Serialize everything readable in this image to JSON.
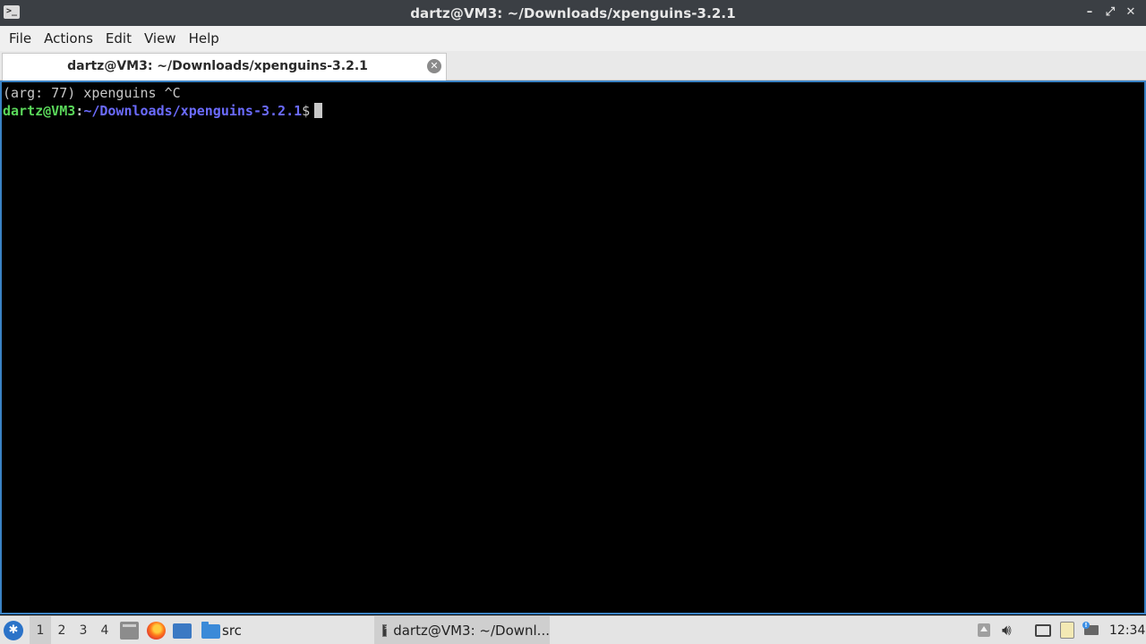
{
  "window": {
    "title": "dartz@VM3: ~/Downloads/xpenguins-3.2.1",
    "minimize_glyph": "–",
    "maximize_glyph": "⤢",
    "close_glyph": "✕"
  },
  "menubar": {
    "items": [
      "File",
      "Actions",
      "Edit",
      "View",
      "Help"
    ]
  },
  "tabs": [
    {
      "label": "dartz@VM3: ~/Downloads/xpenguins-3.2.1",
      "close_glyph": "✕"
    }
  ],
  "terminal": {
    "lines": [
      "(arg: 77) xpenguins ^C"
    ],
    "prompt": {
      "user_host": "dartz@VM3",
      "separator": ":",
      "path": "~/Downloads/xpenguins-3.2.1",
      "symbol": "$"
    },
    "colors": {
      "background": "#000000",
      "text": "#c8c8c8",
      "user_host": "#5ad75a",
      "path": "#6b6bff",
      "border": "#3a82c4"
    }
  },
  "taskbar": {
    "desktops": [
      "1",
      "2",
      "3",
      "4"
    ],
    "active_desktop": "1",
    "quicklaunch": [
      "files-icon",
      "firefox-icon",
      "show-desktop-icon",
      "folder-icon"
    ],
    "folder_label": "src",
    "tasks": [
      {
        "label": "dartz@VM3: ~/Downl..."
      }
    ],
    "tray": [
      "tray-expand-icon",
      "volume-icon",
      "screen-icon",
      "clipboard-icon",
      "network-icon"
    ],
    "clock": "12:34"
  }
}
